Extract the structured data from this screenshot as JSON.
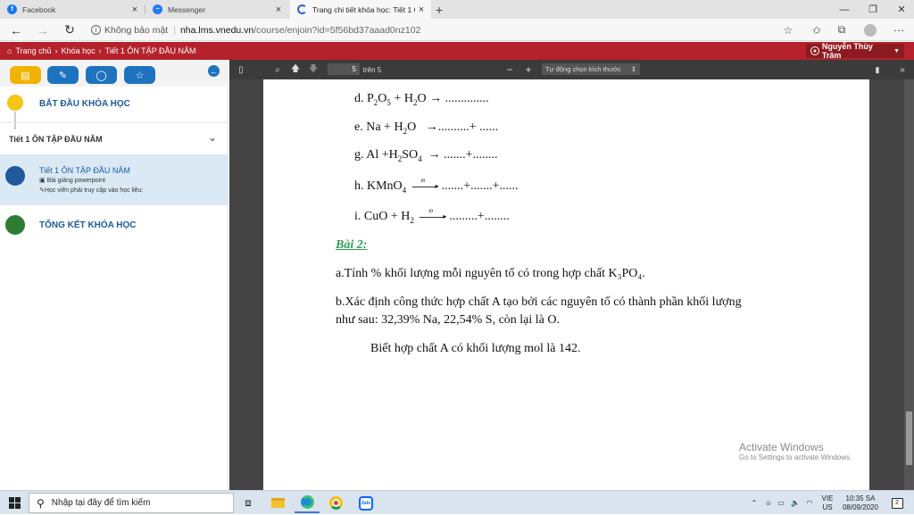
{
  "browser": {
    "tabs": [
      {
        "label": "Facebook",
        "icon": "facebook-icon",
        "color": "#1877f2",
        "active": false
      },
      {
        "label": "Messenger",
        "icon": "messenger-icon",
        "color": "#1f7ef0",
        "active": false
      },
      {
        "label": "Trang chi tiết khóa học: Tiết 1 Ôn",
        "icon": "loading-icon",
        "color": "#2b66c4",
        "active": true
      }
    ],
    "new_tab": "+",
    "window_controls": {
      "minimize": "—",
      "restore": "❐",
      "close": "✕"
    },
    "security_label": "Không bảo mật",
    "url_domain": "nha.lms.vnedu.vn",
    "url_path": "/course/enjoin?id=5f56bd37aaad0nz102",
    "menu": "···"
  },
  "site": {
    "breadcrumb": [
      "Trang chủ",
      "Khóa học",
      "Tiết 1 ÔN TẬP ĐẦU NĂM"
    ],
    "home_icon": "home-icon",
    "user_name": "Nguyễn Thùy Trâm",
    "header_color": "#b5222b"
  },
  "sidebar": {
    "buttons": [
      {
        "icon": "book-icon",
        "color": "#f0b400"
      },
      {
        "icon": "paperclip-icon",
        "color": "#1e73be"
      },
      {
        "icon": "chat-icon",
        "color": "#1e73be"
      },
      {
        "icon": "star-icon",
        "color": "#1e73be"
      }
    ],
    "start_label": "BẮT ĐẦU KHÓA HỌC",
    "section_label": "Tiết 1 ÔN TẬP ĐẦU NĂM",
    "lesson": {
      "title": "Tiết 1 ÔN TẬP ĐẦU NĂM",
      "line1": "Bài giảng powerpoint",
      "line2": "Học viên phải truy cập vào học liệu:"
    },
    "end_label": "TỔNG KẾT KHÓA HỌC",
    "dot_colors": {
      "start": "#f5c518",
      "lesson": "#1e5a9c",
      "end": "#2e7d32"
    }
  },
  "pdf": {
    "page_number": "5",
    "page_of": "trên 5",
    "zoom_label": "Tự động chọn kích thước",
    "equations": {
      "d": {
        "label": "d.",
        "tail": "→ .............."
      },
      "e": {
        "label": "e.",
        "text": "Na + H",
        "tail": "→..........+ ......"
      },
      "g": {
        "label": "g.",
        "text": "Al +H",
        "tail": "→ .......+........"
      },
      "h": {
        "label": "h.",
        "text": "KMnO",
        "tail": ".......+.......+......"
      },
      "i": {
        "label": "i.",
        "text": "CuO + H",
        "tail": ".........+........"
      },
      "arrow_label": "t0"
    },
    "bai2_title": "Bài 2:",
    "bai2_color": "#2e9b57",
    "part_a": "a.Tính % khối lượng mỗi nguyên tố có trong hợp chất K₃PO₄.",
    "part_b1": "b.Xác định công thức hợp chất  A tạo bởi các nguyên tố có thành phần  khối lượng",
    "part_b2": "như sau: 32,39% Na, 22,54% S, còn lại là O.",
    "part_b3": "Biết  hợp chất A có khối lượng mol là 142.",
    "watermark_title": "Activate Windows",
    "watermark_sub": "Go to Settings to activate Windows."
  },
  "taskbar": {
    "search_placeholder": "Nhập tại đây để tìm kiếm",
    "lang_top": "VIE",
    "lang_bottom": "US",
    "time": "10:35 SA",
    "date": "08/09/2020",
    "notif_count": "2"
  }
}
